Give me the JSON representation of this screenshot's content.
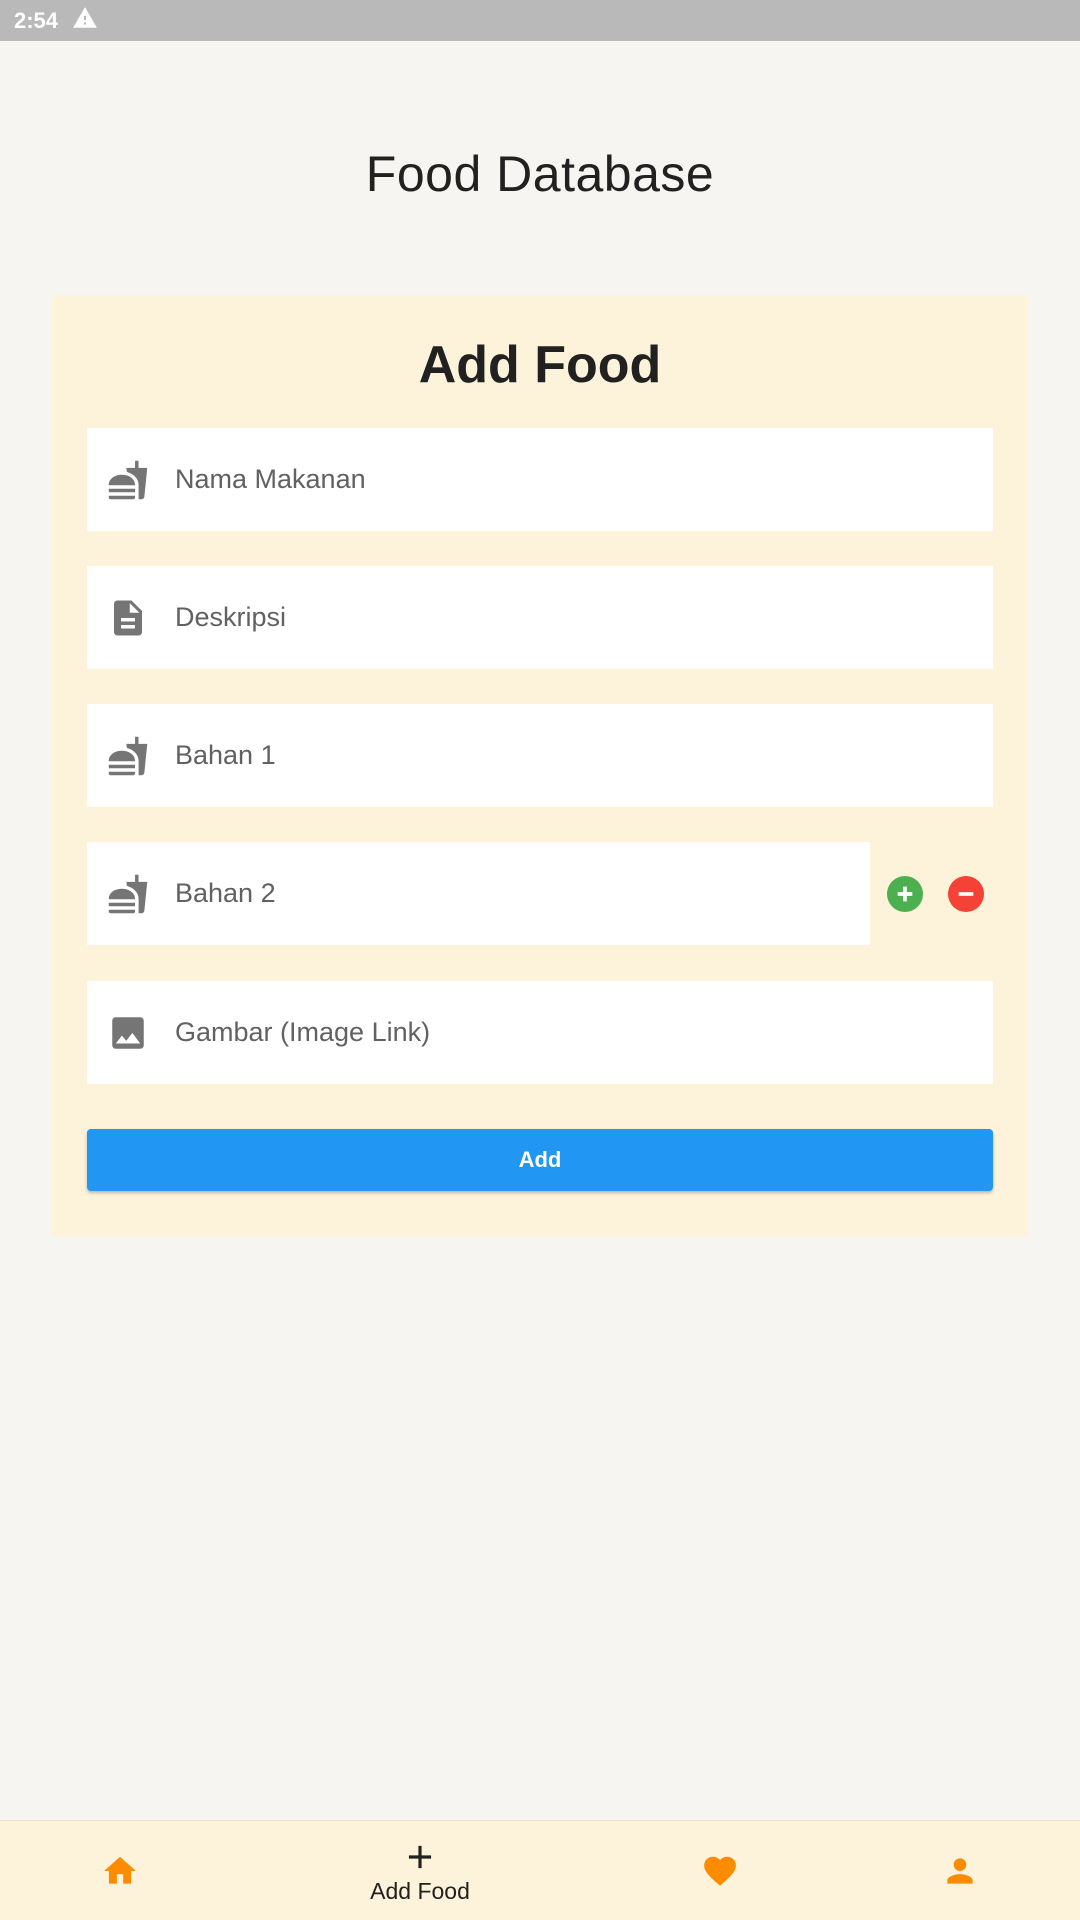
{
  "status_bar": {
    "time": "2:54",
    "alert_icon": "warning-triangle-icon"
  },
  "app": {
    "title": "Food Database"
  },
  "form": {
    "title": "Add Food",
    "fields": {
      "name": {
        "placeholder": "Nama Makanan",
        "icon": "fastfood-icon"
      },
      "description": {
        "placeholder": "Deskripsi",
        "icon": "description-icon"
      },
      "ingredient_1": {
        "placeholder": "Bahan 1",
        "icon": "fastfood-icon"
      },
      "ingredient_2": {
        "placeholder": "Bahan 2",
        "icon": "fastfood-icon"
      },
      "image": {
        "placeholder": "Gambar (Image Link)",
        "icon": "image-icon"
      }
    },
    "add_ingredient_icon": "add-circle-icon",
    "remove_ingredient_icon": "remove-circle-icon",
    "submit_label": "Add"
  },
  "bottom_nav": {
    "items": [
      {
        "icon": "home-icon",
        "label": ""
      },
      {
        "icon": "add-icon",
        "label": "Add Food"
      },
      {
        "icon": "heart-icon",
        "label": ""
      },
      {
        "icon": "person-icon",
        "label": ""
      }
    ]
  },
  "colors": {
    "accent": "#fb8c00",
    "primary_button": "#2196f3",
    "add_green": "#4caf50",
    "remove_red": "#f44336",
    "card_bg": "#fdf2da",
    "page_bg": "#f7f5f1"
  }
}
